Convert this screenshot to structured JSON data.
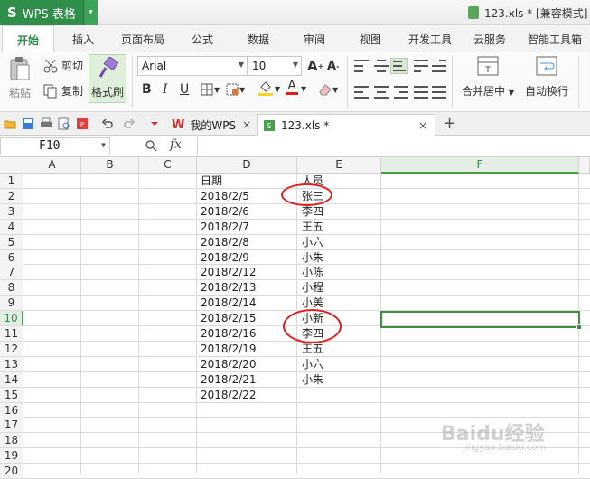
{
  "app": {
    "logo": "S",
    "name": "WPS 表格",
    "dropdown": "▾"
  },
  "window_title": "123.xls * [兼容模式]",
  "menu": [
    "开始",
    "插入",
    "页面布局",
    "公式",
    "数据",
    "审阅",
    "视图",
    "开发工具",
    "云服务",
    "智能工具箱"
  ],
  "ribbon": {
    "paste_label": "粘贴",
    "cut_label": "剪切",
    "copy_label": "复制",
    "format_painter_label": "格式刷",
    "font_name": "Arial",
    "font_size": "10",
    "grow_font": "A",
    "shrink_font": "A",
    "bold": "B",
    "italic": "I",
    "underline": "U",
    "merge_center_label": "合并居中",
    "wrap_text_label": "自动换行",
    "fill_color": "#f5d327",
    "font_color": "#e02020"
  },
  "tabs": [
    {
      "label": "我的WPS",
      "close": "×"
    },
    {
      "label": "123.xls *",
      "close": "×"
    }
  ],
  "new_tab": "+",
  "formula_bar": {
    "cell_ref": "F10",
    "fx": "fx",
    "value": ""
  },
  "columns": [
    "A",
    "B",
    "C",
    "D",
    "E",
    "F"
  ],
  "rows": [
    "1",
    "2",
    "3",
    "4",
    "5",
    "6",
    "7",
    "8",
    "9",
    "10",
    "11",
    "12",
    "13",
    "14",
    "15",
    "16",
    "17",
    "18",
    "19",
    "20"
  ],
  "selected_cell": {
    "column": "F",
    "row": "10"
  },
  "cells": {
    "D": [
      "日期",
      "2018/2/5",
      "2018/2/6",
      "2018/2/7",
      "2018/2/8",
      "2018/2/9",
      "2018/2/12",
      "2018/2/13",
      "2018/2/14",
      "2018/2/15",
      "2018/2/16",
      "2018/2/19",
      "2018/2/20",
      "2018/2/21",
      "2018/2/22"
    ],
    "E": [
      "人员",
      "张三",
      "李四",
      "王五",
      "小六",
      "小朱",
      "小陈",
      "小程",
      "小美",
      "小新",
      "李四",
      "王五",
      "小六",
      "小朱",
      ""
    ]
  },
  "annotations": [
    "highlight E2",
    "highlight E10:E11"
  ],
  "watermark": {
    "text": "Baidu经验",
    "sub": "jingyan.baidu.com"
  },
  "accent": "#2f8f4a"
}
